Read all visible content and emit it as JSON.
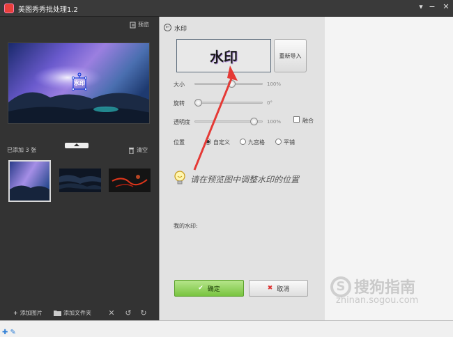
{
  "window": {
    "title": "美图秀秀批处理1.2",
    "controls": [
      "−",
      "■",
      "✕"
    ]
  },
  "left_panel": {
    "preview_label": "预览",
    "watermark_overlay_text": "水印",
    "added_count_label": "已添加 3 张",
    "clear_label": "清空",
    "thumbnails": [
      {
        "name": "thumb-galaxy"
      },
      {
        "name": "thumb-dark-water"
      },
      {
        "name": "thumb-red-lava"
      }
    ],
    "bottom": {
      "add_images_label": "添加图片",
      "add_folder_label": "添加文件夹"
    }
  },
  "right_panel": {
    "title": "水印",
    "watermark_preview_text": "水印",
    "reimport_label": "重新导入",
    "sliders": [
      {
        "key": "size",
        "label": "大小",
        "value_text": "100%",
        "fraction": 0.55
      },
      {
        "key": "rotate",
        "label": "旋转",
        "value_text": "0°",
        "fraction": 0.0
      },
      {
        "key": "opacity",
        "label": "透明度",
        "value_text": "100%",
        "fraction": 0.92
      }
    ],
    "fuse_label": "融合",
    "position_label": "位置",
    "position_options": [
      {
        "label": "自定义",
        "selected": true
      },
      {
        "label": "九宫格",
        "selected": false
      },
      {
        "label": "平铺",
        "selected": false
      }
    ],
    "tip_text": "请在预览图中调整水印的位置",
    "my_watermark_label": "我的水印:",
    "ok_label": "确定",
    "cancel_label": "取消"
  },
  "watermark_logo": {
    "brand": "搜狗指南",
    "url": "zhinan.sogou.com"
  },
  "colors": {
    "accent_green": "#79c440",
    "annotation_red": "#e53935",
    "dark_bg": "#333333"
  }
}
